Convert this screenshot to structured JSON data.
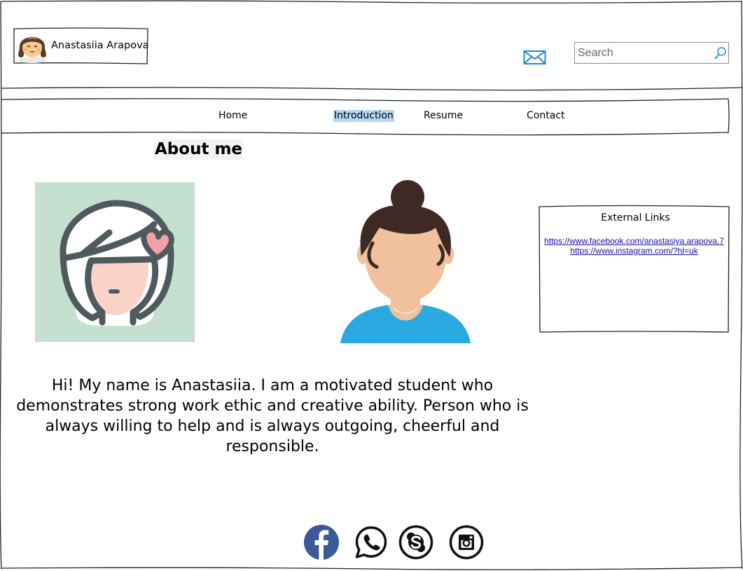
{
  "header": {
    "brand_name": "Anastasiia Arapova",
    "search": {
      "placeholder": "Search",
      "value": ""
    }
  },
  "nav": {
    "items": [
      {
        "label": "Home"
      },
      {
        "label": "Introduction",
        "selected": true
      },
      {
        "label": "Resume"
      },
      {
        "label": "Contact"
      }
    ]
  },
  "main": {
    "section_title": "About me",
    "intro_paragraph": "Hi! My name is Anastasiia. I am a motivated student who demonstrates strong work ethic and creative ability. Person who is always willing to help and is always outgoing, cheerful and responsible."
  },
  "sidebar": {
    "title": "External Links",
    "links": [
      "https://www.facebook.com/anastasiya.arapova.7",
      "https://www.instagram.com/?hl=uk"
    ]
  },
  "footer": {
    "social_icons": [
      "facebook-icon",
      "whatsapp-icon",
      "skype-icon",
      "instagram-icon"
    ]
  },
  "colors": {
    "selection_highlight": "#b5d5f5",
    "link": "#1a0dab",
    "facebook": "#3b5998",
    "mail_icon": "#1e88d6",
    "avatar_bg": "#c3e0d1",
    "shirt": "#2aa9e0",
    "hair": "#3d2a24"
  }
}
